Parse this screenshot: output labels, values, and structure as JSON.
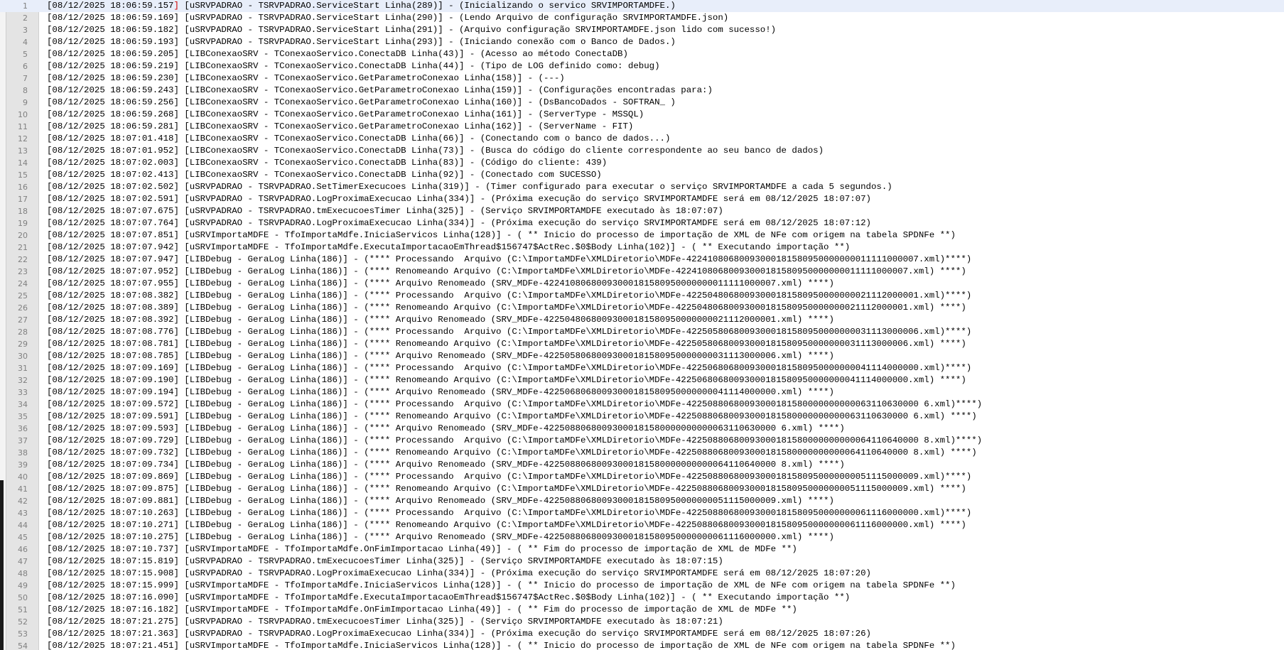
{
  "editor": {
    "current_line": 1,
    "lines": [
      "[08/12/2025 18:06:59.157] [uSRVPADRAO - TSRVPADRAO.ServiceStart Linha(289)] - (Inicializando o servico SRVIMPORTAMDFE.)",
      "[08/12/2025 18:06:59.169] [uSRVPADRAO - TSRVPADRAO.ServiceStart Linha(290)] - (Lendo Arquivo de configuração SRVIMPORTAMDFE.json)",
      "[08/12/2025 18:06:59.182] [uSRVPADRAO - TSRVPADRAO.ServiceStart Linha(291)] - (Arquivo configuração SRVIMPORTAMDFE.json lido com sucesso!)",
      "[08/12/2025 18:06:59.193] [uSRVPADRAO - TSRVPADRAO.ServiceStart Linha(293)] - (Iniciando conexão com o Banco de Dados.)",
      "[08/12/2025 18:06:59.205] [LIBConexaoSRV - TConexaoServico.ConectaDB Linha(43)] - (Acesso ao método ConectaDB)",
      "[08/12/2025 18:06:59.219] [LIBConexaoSRV - TConexaoServico.ConectaDB Linha(44)] - (Tipo de LOG definido como: debug)",
      "[08/12/2025 18:06:59.230] [LIBConexaoSRV - TConexaoServico.GetParametroConexao Linha(158)] - (---)",
      "[08/12/2025 18:06:59.243] [LIBConexaoSRV - TConexaoServico.GetParametroConexao Linha(159)] - (Configurações encontradas para:)",
      "[08/12/2025 18:06:59.256] [LIBConexaoSRV - TConexaoServico.GetParametroConexao Linha(160)] - (DsBancoDados - SOFTRAN_ )",
      "[08/12/2025 18:06:59.268] [LIBConexaoSRV - TConexaoServico.GetParametroConexao Linha(161)] - (ServerType - MSSQL)",
      "[08/12/2025 18:06:59.281] [LIBConexaoSRV - TConexaoServico.GetParametroConexao Linha(162)] - (ServerName - FIT)",
      "[08/12/2025 18:07:01.418] [LIBConexaoSRV - TConexaoServico.ConectaDB Linha(66)] - (Conectando com o banco de dados...)",
      "[08/12/2025 18:07:01.952] [LIBConexaoSRV - TConexaoServico.ConectaDB Linha(73)] - (Busca do código do cliente correspondente ao seu banco de dados)",
      "[08/12/2025 18:07:02.003] [LIBConexaoSRV - TConexaoServico.ConectaDB Linha(83)] - (Código do cliente: 439)",
      "[08/12/2025 18:07:02.413] [LIBConexaoSRV - TConexaoServico.ConectaDB Linha(92)] - (Conectado com SUCESSO)",
      "[08/12/2025 18:07:02.502] [uSRVPADRAO - TSRVPADRAO.SetTimerExecucoes Linha(319)] - (Timer configurado para executar o serviço SRVIMPORTAMDFE a cada 5 segundos.)",
      "[08/12/2025 18:07:02.591] [uSRVPADRAO - TSRVPADRAO.LogProximaExecucao Linha(334)] - (Próxima execução do serviço SRVIMPORTAMDFE será em 08/12/2025 18:07:07)",
      "[08/12/2025 18:07:07.675] [uSRVPADRAO - TSRVPADRAO.tmExecucoesTimer Linha(325)] - (Serviço SRVIMPORTAMDFE executado às 18:07:07)",
      "[08/12/2025 18:07:07.764] [uSRVPADRAO - TSRVPADRAO.LogProximaExecucao Linha(334)] - (Próxima execução do serviço SRVIMPORTAMDFE será em 08/12/2025 18:07:12)",
      "[08/12/2025 18:07:07.851] [uSRVImportaMDFE - TfoImportaMdfe.IniciaServicos Linha(128)] - ( ** Inicio do processo de importação de XML de NFe com origem na tabela SPDNFe **)",
      "[08/12/2025 18:07:07.942] [uSRVImportaMDFE - TfoImportaMdfe.ExecutaImportacaoEmThread$156747$ActRec.$0$Body Linha(102)] - ( ** Executando importação **)",
      "[08/12/2025 18:07:07.947] [LIBDebug - GeraLog Linha(186)] - (**** Processando  Arquivo (C:\\ImportaMDFe\\XMLDiretorio\\MDFe-42241080680093000181580950000000011111000007.xml)****)",
      "[08/12/2025 18:07:07.952] [LIBDebug - GeraLog Linha(186)] - (**** Renomeando Arquivo (C:\\ImportaMDFe\\XMLDiretorio\\MDFe-42241080680093000181580950000000011111000007.xml) ****)",
      "[08/12/2025 18:07:07.955] [LIBDebug - GeraLog Linha(186)] - (**** Arquivo Renomeado (SRV_MDFe-42241080680093000181580950000000011111000007.xml) ****)",
      "[08/12/2025 18:07:08.382] [LIBDebug - GeraLog Linha(186)] - (**** Processando  Arquivo (C:\\ImportaMDFe\\XMLDiretorio\\MDFe-42250480680093000181580950000000021112000001.xml)****)",
      "[08/12/2025 18:07:08.389] [LIBDebug - GeraLog Linha(186)] - (**** Renomeando Arquivo (C:\\ImportaMDFe\\XMLDiretorio\\MDFe-42250480680093000181580950000000021112000001.xml) ****)",
      "[08/12/2025 18:07:08.392] [LIBDebug - GeraLog Linha(186)] - (**** Arquivo Renomeado (SRV_MDFe-42250480680093000181580950000000021112000001.xml) ****)",
      "[08/12/2025 18:07:08.776] [LIBDebug - GeraLog Linha(186)] - (**** Processando  Arquivo (C:\\ImportaMDFe\\XMLDiretorio\\MDFe-42250580680093000181580950000000031113000006.xml)****)",
      "[08/12/2025 18:07:08.781] [LIBDebug - GeraLog Linha(186)] - (**** Renomeando Arquivo (C:\\ImportaMDFe\\XMLDiretorio\\MDFe-42250580680093000181580950000000031113000006.xml) ****)",
      "[08/12/2025 18:07:08.785] [LIBDebug - GeraLog Linha(186)] - (**** Arquivo Renomeado (SRV_MDFe-42250580680093000181580950000000031113000006.xml) ****)",
      "[08/12/2025 18:07:09.169] [LIBDebug - GeraLog Linha(186)] - (**** Processando  Arquivo (C:\\ImportaMDFe\\XMLDiretorio\\MDFe-42250680680093000181580950000000041114000000.xml)****)",
      "[08/12/2025 18:07:09.190] [LIBDebug - GeraLog Linha(186)] - (**** Renomeando Arquivo (C:\\ImportaMDFe\\XMLDiretorio\\MDFe-42250680680093000181580950000000041114000000.xml) ****)",
      "[08/12/2025 18:07:09.194] [LIBDebug - GeraLog Linha(186)] - (**** Arquivo Renomeado (SRV_MDFe-42250680680093000181580950000000041114000000.xml) ****)",
      "[08/12/2025 18:07:09.572] [LIBDebug - GeraLog Linha(186)] - (**** Processando  Arquivo (C:\\ImportaMDFe\\XMLDiretorio\\MDFe-42250880680093000181580000000000063110630000 6.xml)****)",
      "[08/12/2025 18:07:09.591] [LIBDebug - GeraLog Linha(186)] - (**** Renomeando Arquivo (C:\\ImportaMDFe\\XMLDiretorio\\MDFe-42250880680093000181580000000000063110630000 6.xml) ****)",
      "[08/12/2025 18:07:09.593] [LIBDebug - GeraLog Linha(186)] - (**** Arquivo Renomeado (SRV_MDFe-42250880680093000181580000000000063110630000 6.xml) ****)",
      "[08/12/2025 18:07:09.729] [LIBDebug - GeraLog Linha(186)] - (**** Processando  Arquivo (C:\\ImportaMDFe\\XMLDiretorio\\MDFe-42250880680093000181580000000000064110640000 8.xml)****)",
      "[08/12/2025 18:07:09.732] [LIBDebug - GeraLog Linha(186)] - (**** Renomeando Arquivo (C:\\ImportaMDFe\\XMLDiretorio\\MDFe-42250880680093000181580000000000064110640000 8.xml) ****)",
      "[08/12/2025 18:07:09.734] [LIBDebug - GeraLog Linha(186)] - (**** Arquivo Renomeado (SRV_MDFe-42250880680093000181580000000000064110640000 8.xml) ****)",
      "[08/12/2025 18:07:09.869] [LIBDebug - GeraLog Linha(186)] - (**** Processando  Arquivo (C:\\ImportaMDFe\\XMLDiretorio\\MDFe-42250880680093000181580950000000051115000009.xml)****)",
      "[08/12/2025 18:07:09.875] [LIBDebug - GeraLog Linha(186)] - (**** Renomeando Arquivo (C:\\ImportaMDFe\\XMLDiretorio\\MDFe-42250880680093000181580950000000051115000009.xml) ****)",
      "[08/12/2025 18:07:09.881] [LIBDebug - GeraLog Linha(186)] - (**** Arquivo Renomeado (SRV_MDFe-42250880680093000181580950000000051115000009.xml) ****)",
      "[08/12/2025 18:07:10.263] [LIBDebug - GeraLog Linha(186)] - (**** Processando  Arquivo (C:\\ImportaMDFe\\XMLDiretorio\\MDFe-42250880680093000181580950000000061116000000.xml)****)",
      "[08/12/2025 18:07:10.271] [LIBDebug - GeraLog Linha(186)] - (**** Renomeando Arquivo (C:\\ImportaMDFe\\XMLDiretorio\\MDFe-42250880680093000181580950000000061116000000.xml) ****)",
      "[08/12/2025 18:07:10.275] [LIBDebug - GeraLog Linha(186)] - (**** Arquivo Renomeado (SRV_MDFe-42250880680093000181580950000000061116000000.xml) ****)",
      "[08/12/2025 18:07:10.737] [uSRVImportaMDFE - TfoImportaMdfe.OnFimImportacao Linha(49)] - ( ** Fim do processo de importação de XML de MDFe **)",
      "[08/12/2025 18:07:15.819] [uSRVPADRAO - TSRVPADRAO.tmExecucoesTimer Linha(325)] - (Serviço SRVIMPORTAMDFE executado às 18:07:15)",
      "[08/12/2025 18:07:15.908] [uSRVPADRAO - TSRVPADRAO.LogProximaExecucao Linha(334)] - (Próxima execução do serviço SRVIMPORTAMDFE será em 08/12/2025 18:07:20)",
      "[08/12/2025 18:07:15.999] [uSRVImportaMDFE - TfoImportaMdfe.IniciaServicos Linha(128)] - ( ** Inicio do processo de importação de XML de NFe com origem na tabela SPDNFe **)",
      "[08/12/2025 18:07:16.090] [uSRVImportaMDFE - TfoImportaMdfe.ExecutaImportacaoEmThread$156747$ActRec.$0$Body Linha(102)] - ( ** Executando importação **)",
      "[08/12/2025 18:07:16.182] [uSRVImportaMDFE - TfoImportaMdfe.OnFimImportacao Linha(49)] - ( ** Fim do processo de importação de XML de MDFe **)",
      "[08/12/2025 18:07:21.275] [uSRVPADRAO - TSRVPADRAO.tmExecucoesTimer Linha(325)] - (Serviço SRVIMPORTAMDFE executado às 18:07:21)",
      "[08/12/2025 18:07:21.363] [uSRVPADRAO - TSRVPADRAO.LogProximaExecucao Linha(334)] - (Próxima execução do serviço SRVIMPORTAMDFE será em 08/12/2025 18:07:26)",
      "[08/12/2025 18:07:21.451] [uSRVImportaMDFE - TfoImportaMdfe.IniciaServicos Linha(128)] - ( ** Inicio do processo de importação de XML de NFe com origem na tabela SPDNFe **)"
    ]
  },
  "colors": {
    "gutter_bg": "#e4e4e4",
    "current_line_bg": "#e8eefa",
    "line_number": "#808080",
    "caret": "#d00000"
  }
}
